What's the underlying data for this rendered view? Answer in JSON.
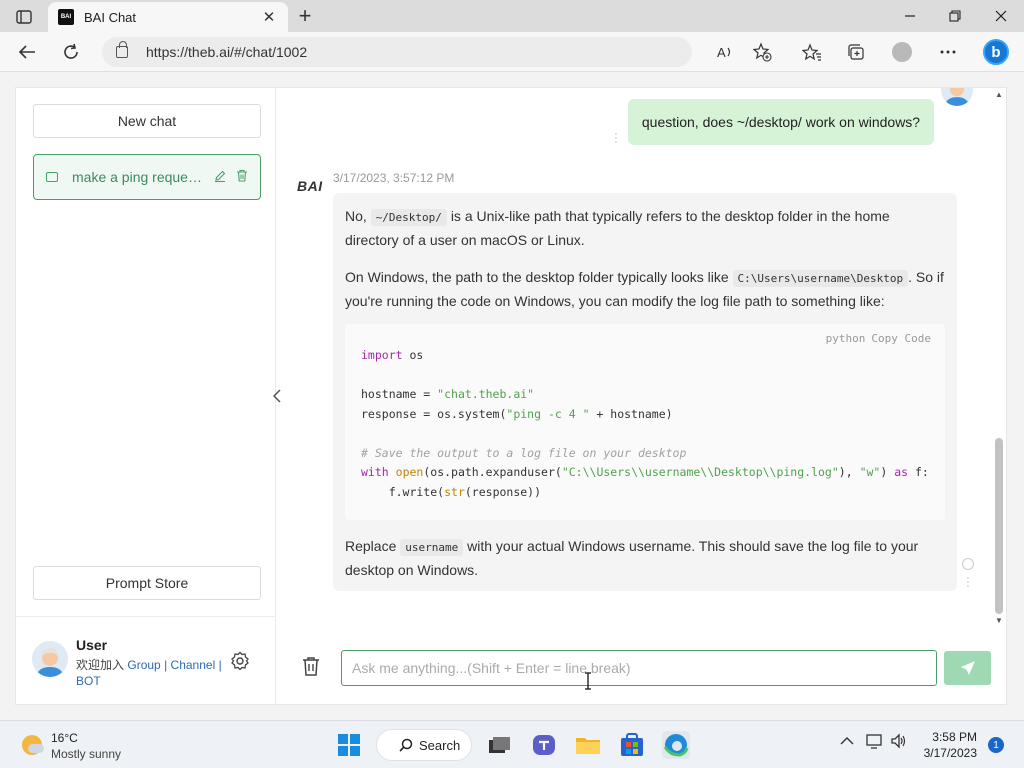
{
  "browser": {
    "tab_title": "BAI Chat",
    "favicon_text": "BAI",
    "url": "https://theb.ai/#/chat/1002",
    "icons": [
      "tab-actions-icon",
      "close-icon",
      "new-tab-icon",
      "minimize-icon",
      "restore-icon",
      "close-window-icon",
      "back-icon",
      "refresh-icon",
      "lock-icon",
      "read-aloud-icon",
      "add-favorite-icon",
      "favorites-icon",
      "collections-icon",
      "profile-icon",
      "more-icon",
      "bing-icon"
    ],
    "bing_label": "b"
  },
  "sidebar": {
    "new_chat_label": "New chat",
    "chat_items": [
      {
        "title": "make a ping reques..."
      }
    ],
    "prompt_store_label": "Prompt Store",
    "user": {
      "name": "User",
      "welcome": "欢迎加入",
      "group_link": "Group",
      "separator": "|",
      "channel_link": "Channel",
      "bot_link": "BOT"
    }
  },
  "conversation": {
    "user_message": "question, does ~/desktop/ work on windows?",
    "bot_logo": "BAI",
    "bot_timestamp": "3/17/2023, 3:57:12 PM",
    "bot": {
      "p1_before": "No,",
      "p1_code": "~/Desktop/",
      "p1_after": "is a Unix-like path that typically refers to the desktop folder in the home directory of a user on macOS or Linux.",
      "p2_before": "On Windows, the path to the desktop folder typically looks like",
      "p2_code": "C:\\Users\\username\\Desktop",
      "p2_after": ". So if you're running the code on Windows, you can modify the log file path to something like:",
      "code_lang": "python",
      "copy_label": "Copy Code",
      "code": {
        "l1_kw": "import",
        "l1_rest": " os",
        "l3_a": "hostname = ",
        "l3_str": "\"chat.theb.ai\"",
        "l4_a": "response = os.system(",
        "l4_str": "\"ping -c 4 \"",
        "l4_b": " + hostname)",
        "l6_comment": "# Save the output to a log file on your desktop",
        "l7_kw": "with",
        "l7_fn": "open",
        "l7_a": "(os.path.expanduser(",
        "l7_str": "\"C:\\\\Users\\\\username\\\\Desktop\\\\ping.log\"",
        "l7_b": "), ",
        "l7_str2": "\"w\"",
        "l7_c": ") ",
        "l7_kw2": "as",
        "l7_d": " f:",
        "l8_a": "    f.write(",
        "l8_fn": "str",
        "l8_b": "(response))"
      },
      "p3_before": "Replace",
      "p3_code": "username",
      "p3_after": "with your actual Windows username. This should save the log file to your desktop on Windows."
    }
  },
  "input": {
    "placeholder": "Ask me anything...(Shift + Enter = line break)",
    "value": ""
  },
  "colors": {
    "accent": "#4a9e6a",
    "user_bubble": "#d6f3d8",
    "send_button": "#9ed9b3"
  },
  "taskbar": {
    "weather_temp": "16°C",
    "weather_desc": "Mostly sunny",
    "search_label": "Search",
    "time": "3:58 PM",
    "date": "3/17/2023",
    "notification_count": "1",
    "apps": [
      "start-icon",
      "task-view-icon",
      "teams-icon",
      "file-explorer-icon",
      "store-icon",
      "edge-icon"
    ]
  }
}
